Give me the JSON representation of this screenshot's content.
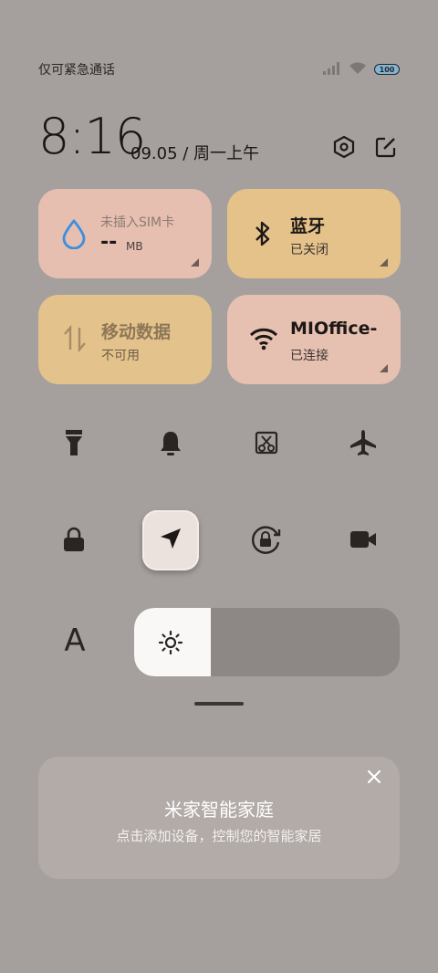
{
  "status_bar": {
    "carrier_text": "仅可紧急通话",
    "battery_level": "100",
    "icons": [
      "signal-icon",
      "wifi-icon",
      "battery-icon"
    ]
  },
  "header": {
    "time": "8:16",
    "date": "09.05 / 周一上午",
    "settings_icon": "settings-icon",
    "edit_icon": "edit-icon"
  },
  "tiles": {
    "sim": {
      "title": "未插入SIM卡",
      "value": "--",
      "unit": "MB",
      "icon": "water-drop-icon"
    },
    "bluetooth": {
      "title": "蓝牙",
      "status": "已关闭",
      "icon": "bluetooth-icon"
    },
    "mobile_data": {
      "title": "移动数据",
      "status": "不可用",
      "icon": "data-arrows-icon"
    },
    "wifi": {
      "title": "MIOffice-",
      "status": "已连接",
      "icon": "wifi-icon"
    }
  },
  "toggles": [
    {
      "name": "flashlight",
      "icon": "flashlight-icon"
    },
    {
      "name": "ringer",
      "icon": "bell-icon"
    },
    {
      "name": "screenshot",
      "icon": "screenshot-icon"
    },
    {
      "name": "airplane",
      "icon": "airplane-icon"
    },
    {
      "name": "lock",
      "icon": "lock-icon"
    },
    {
      "name": "location",
      "icon": "location-arrow-icon",
      "active": true
    },
    {
      "name": "rotation-lock",
      "icon": "rotation-lock-icon"
    },
    {
      "name": "screen-record",
      "icon": "video-camera-icon"
    }
  ],
  "brightness": {
    "auto_label": "A",
    "level_fraction": 0.29,
    "icon": "sun-icon"
  },
  "smart_home_card": {
    "title": "米家智能家庭",
    "subtitle": "点击添加设备，控制您的智能家居",
    "close_icon": "close-icon"
  },
  "colors": {
    "background": "#a59f9d",
    "tile_pink": "#e6bfb0",
    "tile_yellow": "#e6c28b",
    "drop_blue": "#3a8ee0"
  }
}
